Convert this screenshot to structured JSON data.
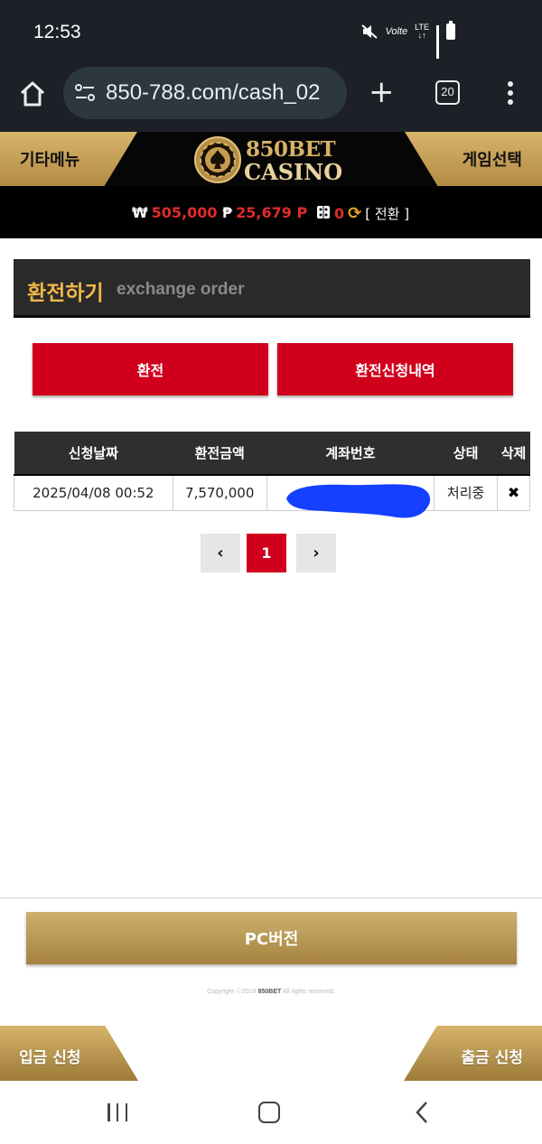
{
  "status_bar": {
    "time": "12:53",
    "volte": "Volte",
    "lte": "LTE",
    "icons": [
      "mute-icon",
      "volte-icon",
      "lte-icon",
      "signal-icon",
      "battery-icon"
    ]
  },
  "browser": {
    "url": "850-788.com/cash_02",
    "tab_count": "20",
    "icons": [
      "home-icon",
      "site-settings-icon",
      "plus-icon",
      "tabs-icon",
      "more-icon"
    ]
  },
  "site_header": {
    "left_menu": "기타메뉴",
    "right_menu": "게임선택",
    "logo_top": "850BET",
    "logo_bottom": "CASINO"
  },
  "balances": {
    "won_symbol": "₩",
    "won_value": "505,000",
    "point_symbol": "₱",
    "point_value": "25,679 P",
    "chip_value": "0",
    "convert_label": "[ 전환 ]"
  },
  "page": {
    "title_ko": "환전하기",
    "title_en": "exchange order"
  },
  "buttons": {
    "exchange": "환전",
    "history": "환전신청내역"
  },
  "table": {
    "headers": [
      "신청날짜",
      "환전금액",
      "계좌번호",
      "상태",
      "삭제"
    ],
    "rows": [
      {
        "date": "2025/04/08 00:52",
        "amount": "7,570,000",
        "account": "",
        "status": "처리중",
        "delete": "✖"
      }
    ]
  },
  "pagination": {
    "prev": "‹",
    "current": "1",
    "next": "›"
  },
  "footer": {
    "pc_version": "PC버전",
    "copyright_prefix": "Copyright ⓒ2018 ",
    "copyright_brand": "850BET",
    "copyright_suffix": " All rights reserved.",
    "deposit": "입금 신청",
    "withdraw": "출금 신청"
  },
  "colors": {
    "accent_red": "#d0001d",
    "gold": "#c9a55c",
    "title_gold": "#f0b749",
    "browser_dark": "#1d2127"
  }
}
